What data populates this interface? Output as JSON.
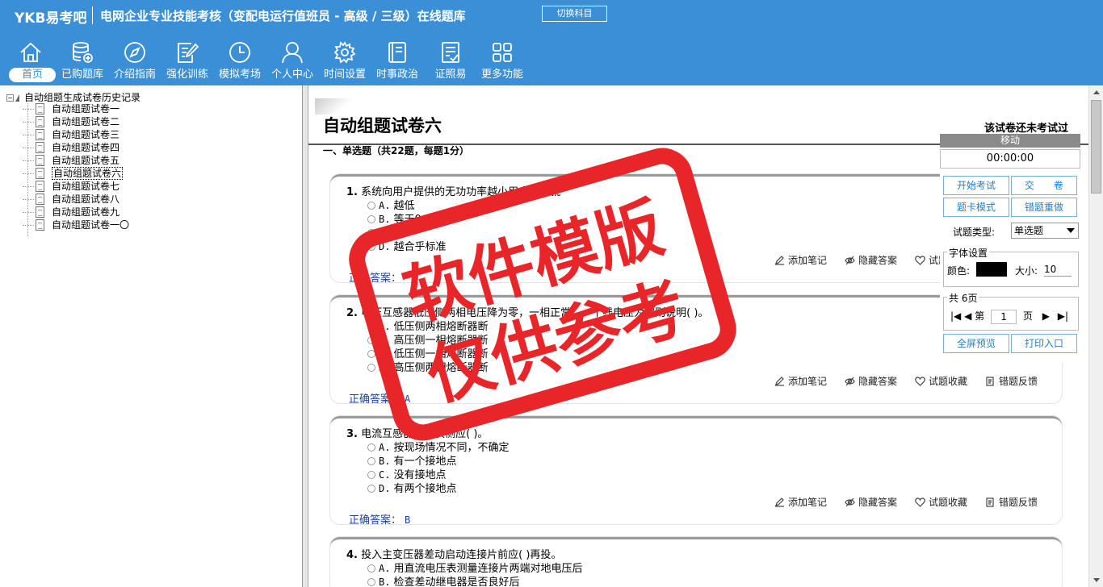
{
  "header": {
    "brand": "YKB易考吧",
    "title": "电网企业专业技能考核（变配电运行值班员 - 高级 / 三级）在线题库",
    "switch_label": "切换科目"
  },
  "nav": [
    {
      "label": "首页",
      "icon": "home-icon"
    },
    {
      "label": "已购题库",
      "icon": "database-icon"
    },
    {
      "label": "介绍指南",
      "icon": "compass-icon"
    },
    {
      "label": "强化训练",
      "icon": "edit-icon"
    },
    {
      "label": "模拟考场",
      "icon": "clock-icon"
    },
    {
      "label": "个人中心",
      "icon": "user-icon"
    },
    {
      "label": "时间设置",
      "icon": "gear-icon"
    },
    {
      "label": "时事政治",
      "icon": "book-icon"
    },
    {
      "label": "证照易",
      "icon": "checklist-icon"
    },
    {
      "label": "更多功能",
      "icon": "grid-icon"
    }
  ],
  "tree": {
    "root": "自动组题生成试卷历史记录",
    "items": [
      "自动组题试卷一",
      "自动组题试卷二",
      "自动组题试卷三",
      "自动组题试卷四",
      "自动组题试卷五",
      "自动组题试卷六",
      "自动组题试卷七",
      "自动组题试卷八",
      "自动组题试卷九",
      "自动组题试卷一〇"
    ],
    "selected_index": 5
  },
  "paper": {
    "title": "自动组题试卷六",
    "status": "该试卷还未考试过",
    "section": "一、单选题（共22题，每题1分）"
  },
  "actions": {
    "note": "添加笔记",
    "hide": "隐藏答案",
    "fav": "试题收藏",
    "feedback": "错题反馈"
  },
  "answer_label": "正确答案：",
  "questions": [
    {
      "num": "1.",
      "stem": "系统向用户提供的无功功率越小用户电压就",
      "options": [
        {
          "letter": "A.",
          "text": "越低"
        },
        {
          "letter": "B.",
          "text": "等于0"
        },
        {
          "letter": "C.",
          "text": "越"
        },
        {
          "letter": "D.",
          "text": "越合乎标准"
        }
      ],
      "answer": ""
    },
    {
      "num": "2.",
      "stem": "电压互感器低压侧两相电压降为零，一相正常，一个线电压为零则说明(  )。",
      "options": [
        {
          "letter": "A.",
          "text": "低压侧两相熔断器断"
        },
        {
          "letter": "B.",
          "text": "高压侧一相熔断器断"
        },
        {
          "letter": "C.",
          "text": "低压侧一相熔断器断"
        },
        {
          "letter": "D.",
          "text": "高压侧两相熔断器断"
        }
      ],
      "answer": "A"
    },
    {
      "num": "3.",
      "stem": "电流互感器的二次侧应(  )。",
      "options": [
        {
          "letter": "A.",
          "text": "按现场情况不同，不确定"
        },
        {
          "letter": "B.",
          "text": "有一个接地点"
        },
        {
          "letter": "C.",
          "text": "没有接地点"
        },
        {
          "letter": "D.",
          "text": "有两个接地点"
        }
      ],
      "answer": "B"
    },
    {
      "num": "4.",
      "stem": "投入主变压器差动启动连接片前应(  )再投。",
      "options": [
        {
          "letter": "A.",
          "text": "用直流电压表测量连接片两端对地电压后"
        },
        {
          "letter": "B.",
          "text": "检查差动继电器是否良好后"
        }
      ],
      "answer": ""
    }
  ],
  "control": {
    "move": "移动",
    "timer": "00:00:00",
    "start": "开始考试",
    "submit": "交　　卷",
    "card_mode": "题卡模式",
    "redo_wrong": "错题重做",
    "qtype_label": "试题类型:",
    "qtype_value": "单选题",
    "font_legend": "字体设置",
    "color_label": "颜色:",
    "size_label": "大小:",
    "size_value": "10",
    "pages_legend": "共 6页",
    "page_prefix": "第",
    "page_value": "1",
    "page_suffix": "页",
    "fullscreen": "全屏预览",
    "print": "打印入口"
  },
  "watermark": {
    "line1": "软件模版",
    "line2": "仅供参考",
    "color": "#e8262a"
  }
}
